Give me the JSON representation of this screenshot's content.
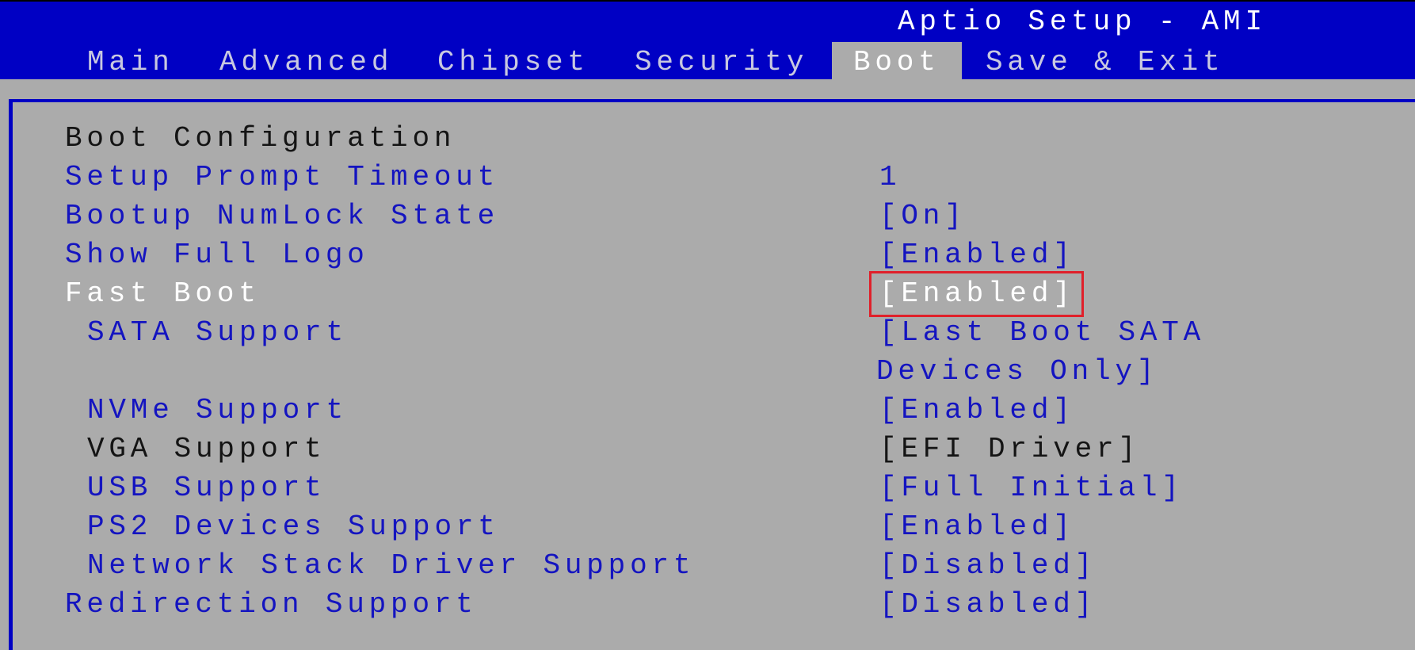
{
  "app_title": "Aptio Setup - AMI",
  "tabs": [
    {
      "label": "Main",
      "active": false
    },
    {
      "label": "Advanced",
      "active": false
    },
    {
      "label": "Chipset",
      "active": false
    },
    {
      "label": "Security",
      "active": false
    },
    {
      "label": "Boot",
      "active": true
    },
    {
      "label": "Save & Exit",
      "active": false
    }
  ],
  "section_title": "Boot Configuration",
  "settings": [
    {
      "label": "Setup Prompt Timeout",
      "value": "1"
    },
    {
      "label": "Bootup NumLock State",
      "value": "[On]"
    },
    {
      "label": "Show Full Logo",
      "value": "[Enabled]"
    },
    {
      "label": "Fast Boot",
      "value": "[Enabled]",
      "selected": true,
      "highlighted": true
    },
    {
      "label": "SATA Support",
      "value": "[Last Boot SATA",
      "value_cont": "Devices Only]"
    },
    {
      "label": "NVMe Support",
      "value": "[Enabled]"
    },
    {
      "label": "VGA Support",
      "value": "[EFI Driver]",
      "read_only": true
    },
    {
      "label": "USB Support",
      "value": "[Full Initial]"
    },
    {
      "label": "PS2 Devices Support",
      "value": "[Enabled]"
    },
    {
      "label": "Network Stack Driver Support",
      "value": "[Disabled]"
    },
    {
      "label": "Redirection Support",
      "value": "[Disabled]"
    }
  ],
  "colors": {
    "header_blue": "#0000c4",
    "background_gray": "#ababab",
    "option_blue": "#1414c0",
    "highlight_red": "#e0202a"
  }
}
